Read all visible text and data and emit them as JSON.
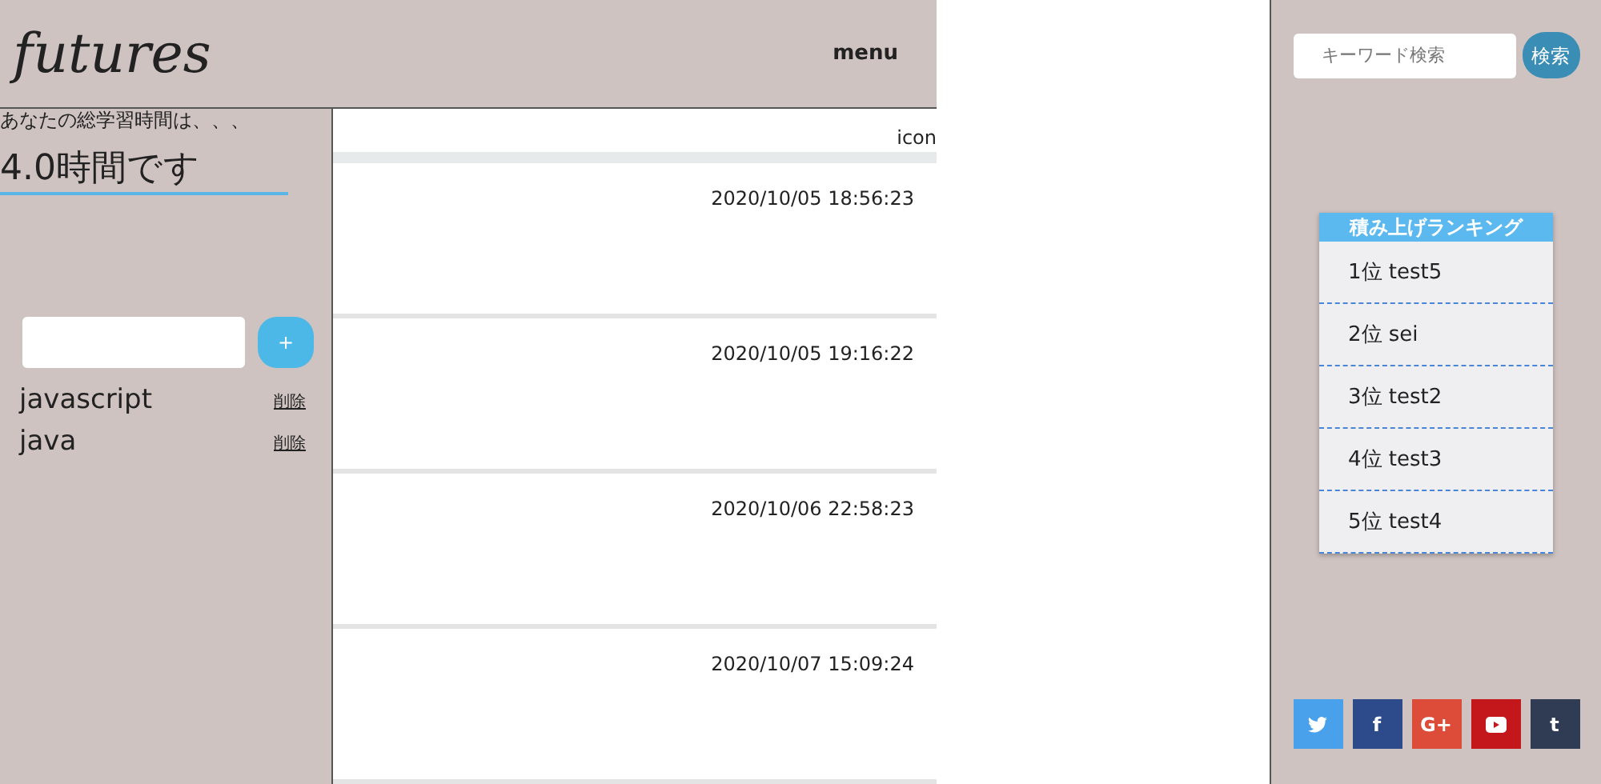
{
  "header": {
    "logo": "futures",
    "menu": "menu"
  },
  "study": {
    "label": "あなたの総学習時間は、、、",
    "total": "4.0時間です"
  },
  "tags": {
    "add_button": "+",
    "items": [
      {
        "name": "javascript",
        "delete": "削除"
      },
      {
        "name": "java",
        "delete": "削除"
      }
    ]
  },
  "feed": {
    "icon_label": "icon",
    "posts": [
      {
        "time": "2020/10/05 18:56:23"
      },
      {
        "time": "2020/10/05 19:16:22"
      },
      {
        "time": "2020/10/06 22:58:23"
      },
      {
        "time": "2020/10/07 15:09:24"
      }
    ]
  },
  "search": {
    "placeholder": "キーワード検索",
    "button": "検索"
  },
  "ranking": {
    "title": "積み上げランキング",
    "items": [
      "1位 test5",
      "2位 sei",
      "3位 test2",
      "4位 test3",
      "5位 test4"
    ]
  },
  "social": [
    {
      "kind": "twitter",
      "color": "#4aa1eb"
    },
    {
      "kind": "letter",
      "glyph": "f",
      "color": "#2d4a8a"
    },
    {
      "kind": "letter",
      "glyph": "G+",
      "color": "#dd4b39"
    },
    {
      "kind": "youtube",
      "color": "#c4171b"
    },
    {
      "kind": "letter",
      "glyph": "t",
      "color": "#2f3c53"
    }
  ]
}
